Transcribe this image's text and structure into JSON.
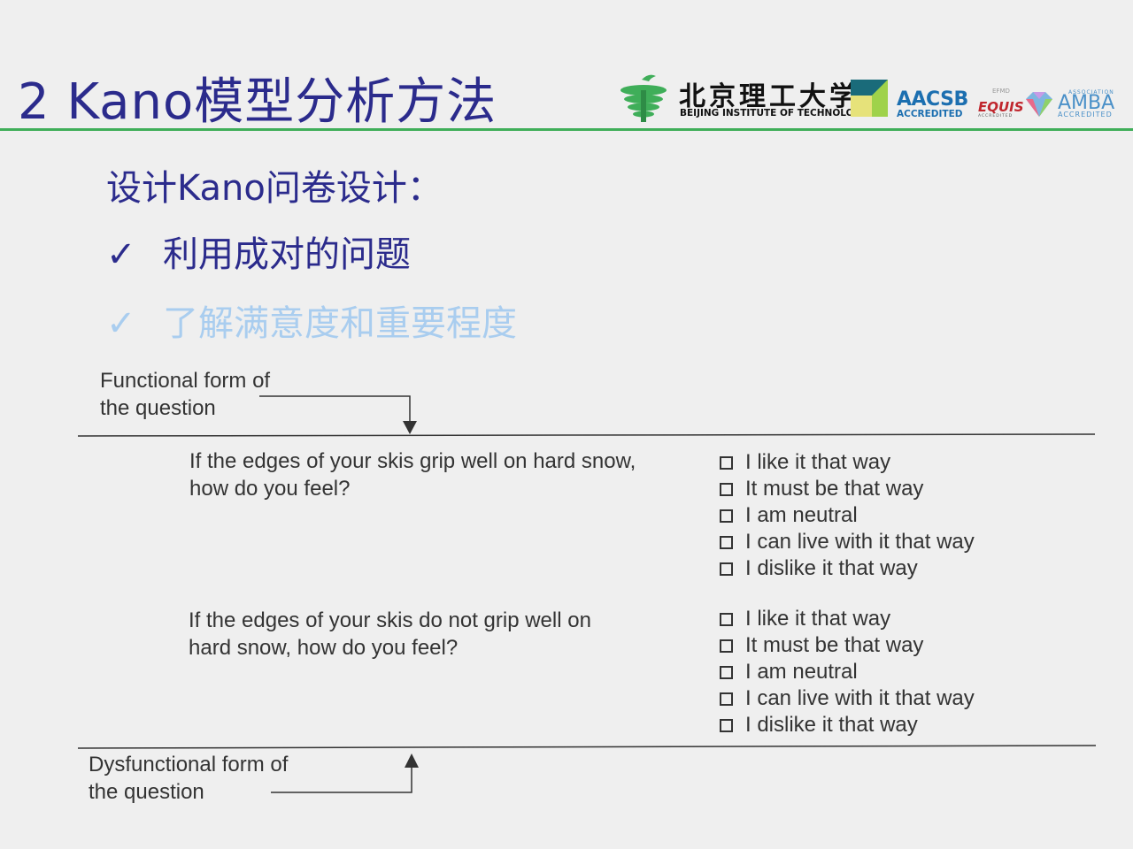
{
  "slide": {
    "title": "2 Kano模型分析方法",
    "heading": "设计Kano问卷设计：",
    "bullets": [
      {
        "check": "✓",
        "text": "利用成对的问题",
        "emphasis": "active"
      },
      {
        "check": "✓",
        "text": "了解满意度和重要程度",
        "emphasis": "faded"
      }
    ]
  },
  "logos": {
    "bit_cn": "北京理工大学",
    "bit_en": "BEIJING INSTITUTE OF TECHNOLOGY",
    "aacsb": "AACSB",
    "aacsb_sub": "ACCREDITED",
    "efmd": "EFMD",
    "equis": "EQUIS",
    "equis_sub": "ACCREDITED",
    "amba_assoc": "ASSOCIATION",
    "amba": "AMBA",
    "amba_sub": "ACCREDITED"
  },
  "figure": {
    "functional_label": [
      "Functional form of",
      "the question"
    ],
    "dysfunctional_label": [
      "Dysfunctional form of",
      "the question"
    ],
    "question_functional": [
      "If the edges of your skis grip well on hard snow,",
      "how do you feel?"
    ],
    "question_dysfunctional": [
      "If the edges of your skis do not grip well on",
      "hard snow, how do you feel?"
    ],
    "options": [
      "I like it that way",
      "It must be that way",
      "I am neutral",
      "I can live with it that way",
      "I dislike it that way"
    ]
  },
  "colors": {
    "title": "#2b2b8c",
    "rule": "#3fae59",
    "faded_bullet": "#a9cdef",
    "figure_text": "#333333"
  }
}
